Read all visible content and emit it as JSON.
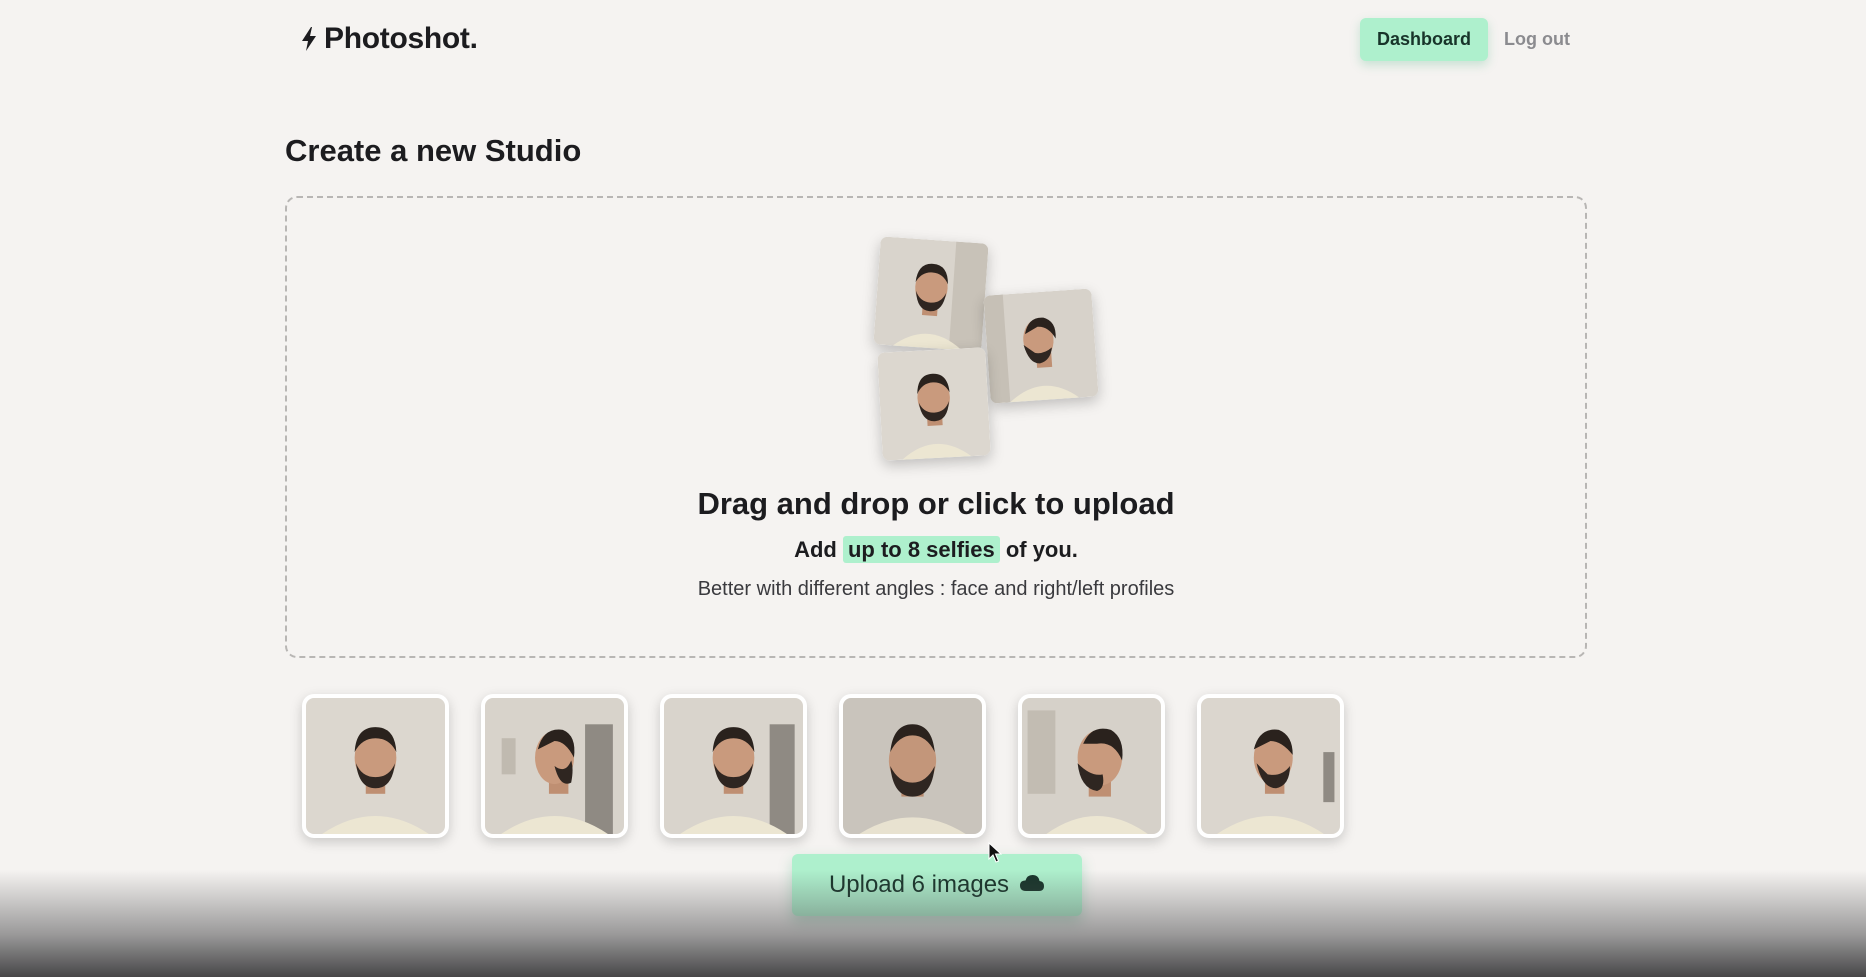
{
  "header": {
    "logo_text": "Photoshot.",
    "logo_icon": "lightning-bolt-icon",
    "nav": {
      "dashboard_label": "Dashboard",
      "logout_label": "Log out"
    }
  },
  "page": {
    "title": "Create a new Studio"
  },
  "dropzone": {
    "heading": "Drag and drop or click to upload",
    "sub_before": "Add",
    "sub_highlight": "up to 8 selfies",
    "sub_after": "of you.",
    "hint": "Better with different angles : face and right/left profiles"
  },
  "thumbnails": [
    {
      "alt": "selfie-1"
    },
    {
      "alt": "selfie-2"
    },
    {
      "alt": "selfie-3"
    },
    {
      "alt": "selfie-4"
    },
    {
      "alt": "selfie-5"
    },
    {
      "alt": "selfie-6"
    }
  ],
  "upload_button": {
    "label": "Upload 6 images",
    "icon": "cloud-icon"
  },
  "colors": {
    "background": "#f5f3f1",
    "accent": "#aef0cd",
    "text": "#1c1c1f",
    "muted": "#8b8b8f"
  }
}
